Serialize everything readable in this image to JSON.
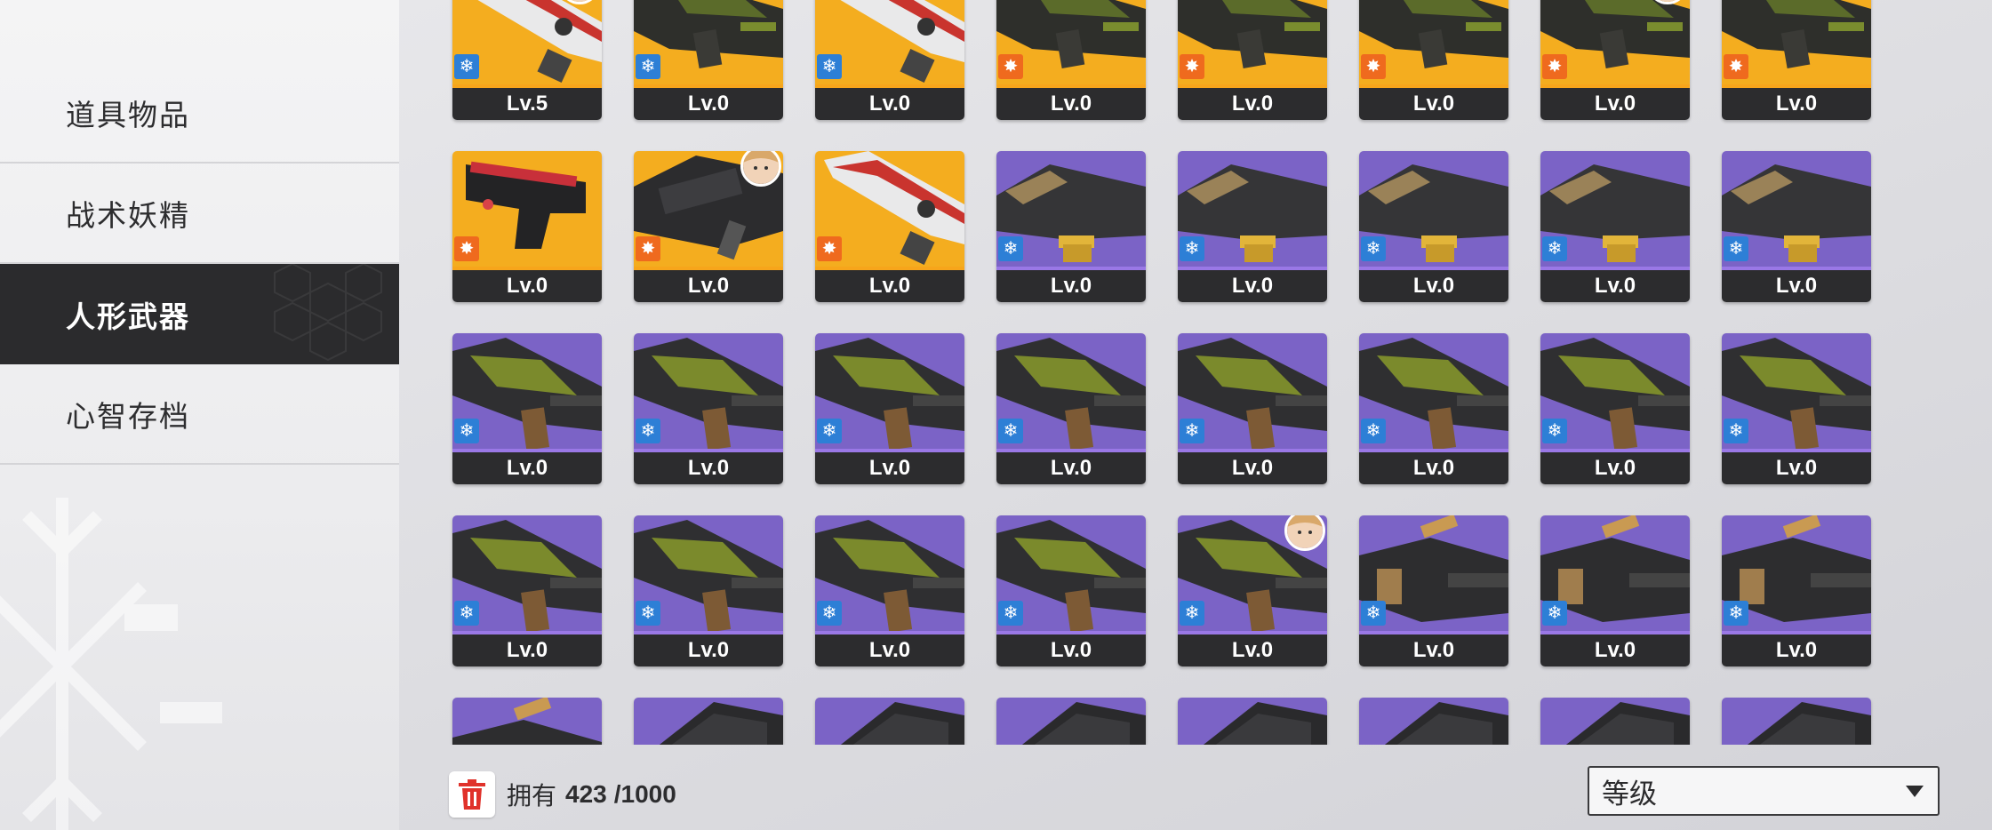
{
  "sidebar": {
    "items": [
      {
        "label": "道具物品",
        "active": false
      },
      {
        "label": "战术妖精",
        "active": false
      },
      {
        "label": "人形武器",
        "active": true
      },
      {
        "label": "心智存档",
        "active": false
      }
    ]
  },
  "colors": {
    "gold_bg": "#f4ad1f",
    "purple_bg": "#7b63c6",
    "gold_bar": "#f7a51b",
    "purple_bar": "#9a78e6",
    "freeze": "#2d7fd6",
    "burn": "#ef6a1e"
  },
  "weapons": [
    {
      "level": "Lv.5",
      "rarity": "gold",
      "element": "freeze",
      "art": "rifle-white",
      "avatar": true
    },
    {
      "level": "Lv.0",
      "rarity": "gold",
      "element": "freeze",
      "art": "rifle-green",
      "avatar": false
    },
    {
      "level": "Lv.0",
      "rarity": "gold",
      "element": "freeze",
      "art": "rifle-white",
      "avatar": false
    },
    {
      "level": "Lv.0",
      "rarity": "gold",
      "element": "burn",
      "art": "rifle-green",
      "avatar": false
    },
    {
      "level": "Lv.0",
      "rarity": "gold",
      "element": "burn",
      "art": "rifle-green",
      "avatar": false
    },
    {
      "level": "Lv.0",
      "rarity": "gold",
      "element": "burn",
      "art": "rifle-green",
      "avatar": false
    },
    {
      "level": "Lv.0",
      "rarity": "gold",
      "element": "burn",
      "art": "rifle-green",
      "avatar": true
    },
    {
      "level": "Lv.0",
      "rarity": "gold",
      "element": "burn",
      "art": "rifle-green",
      "avatar": false
    },
    {
      "level": "Lv.0",
      "rarity": "gold",
      "element": "burn",
      "art": "pistol-red",
      "avatar": false
    },
    {
      "level": "Lv.0",
      "rarity": "gold",
      "element": "burn",
      "art": "rifle-black",
      "avatar": true
    },
    {
      "level": "Lv.0",
      "rarity": "gold",
      "element": "burn",
      "art": "rifle-white",
      "avatar": false
    },
    {
      "level": "Lv.0",
      "rarity": "purple",
      "element": "freeze",
      "art": "smg-tan",
      "avatar": false
    },
    {
      "level": "Lv.0",
      "rarity": "purple",
      "element": "freeze",
      "art": "smg-tan",
      "avatar": false
    },
    {
      "level": "Lv.0",
      "rarity": "purple",
      "element": "freeze",
      "art": "smg-tan",
      "avatar": false
    },
    {
      "level": "Lv.0",
      "rarity": "purple",
      "element": "freeze",
      "art": "smg-tan",
      "avatar": false
    },
    {
      "level": "Lv.0",
      "rarity": "purple",
      "element": "freeze",
      "art": "smg-tan",
      "avatar": false
    },
    {
      "level": "Lv.0",
      "rarity": "purple",
      "element": "freeze",
      "art": "ar-olive",
      "avatar": false
    },
    {
      "level": "Lv.0",
      "rarity": "purple",
      "element": "freeze",
      "art": "ar-olive",
      "avatar": false
    },
    {
      "level": "Lv.0",
      "rarity": "purple",
      "element": "freeze",
      "art": "ar-olive",
      "avatar": false
    },
    {
      "level": "Lv.0",
      "rarity": "purple",
      "element": "freeze",
      "art": "ar-olive",
      "avatar": false
    },
    {
      "level": "Lv.0",
      "rarity": "purple",
      "element": "freeze",
      "art": "ar-olive",
      "avatar": false
    },
    {
      "level": "Lv.0",
      "rarity": "purple",
      "element": "freeze",
      "art": "ar-olive",
      "avatar": false
    },
    {
      "level": "Lv.0",
      "rarity": "purple",
      "element": "freeze",
      "art": "ar-olive",
      "avatar": false
    },
    {
      "level": "Lv.0",
      "rarity": "purple",
      "element": "freeze",
      "art": "ar-olive",
      "avatar": false
    },
    {
      "level": "Lv.0",
      "rarity": "purple",
      "element": "freeze",
      "art": "ar-olive",
      "avatar": false
    },
    {
      "level": "Lv.0",
      "rarity": "purple",
      "element": "freeze",
      "art": "ar-olive",
      "avatar": false
    },
    {
      "level": "Lv.0",
      "rarity": "purple",
      "element": "freeze",
      "art": "ar-olive",
      "avatar": false
    },
    {
      "level": "Lv.0",
      "rarity": "purple",
      "element": "freeze",
      "art": "ar-olive",
      "avatar": false
    },
    {
      "level": "Lv.0",
      "rarity": "purple",
      "element": "freeze",
      "art": "ar-olive",
      "avatar": true
    },
    {
      "level": "Lv.0",
      "rarity": "purple",
      "element": "freeze",
      "art": "mg-tan",
      "avatar": false
    },
    {
      "level": "Lv.0",
      "rarity": "purple",
      "element": "freeze",
      "art": "mg-tan",
      "avatar": false
    },
    {
      "level": "Lv.0",
      "rarity": "purple",
      "element": "freeze",
      "art": "mg-tan",
      "avatar": false
    },
    {
      "level": "",
      "rarity": "purple",
      "element": "",
      "art": "mg-tan",
      "avatar": false
    },
    {
      "level": "",
      "rarity": "purple",
      "element": "",
      "art": "dark",
      "avatar": false
    },
    {
      "level": "",
      "rarity": "purple",
      "element": "",
      "art": "dark",
      "avatar": false
    },
    {
      "level": "",
      "rarity": "purple",
      "element": "",
      "art": "dark",
      "avatar": false
    },
    {
      "level": "",
      "rarity": "purple",
      "element": "",
      "art": "dark",
      "avatar": false
    },
    {
      "level": "",
      "rarity": "purple",
      "element": "",
      "art": "dark",
      "avatar": false
    },
    {
      "level": "",
      "rarity": "purple",
      "element": "",
      "art": "dark",
      "avatar": false
    },
    {
      "level": "",
      "rarity": "purple",
      "element": "",
      "art": "dark",
      "avatar": false
    }
  ],
  "footer": {
    "owned_label": "拥有",
    "owned_count": "423",
    "owned_max": "/1000",
    "sort_value": "等级"
  }
}
